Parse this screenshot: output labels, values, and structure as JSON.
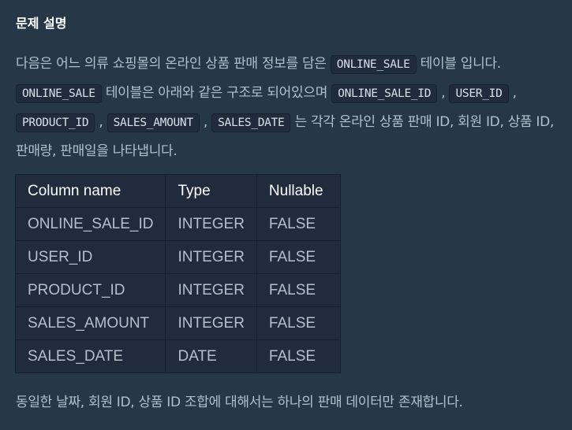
{
  "heading": "문제 설명",
  "intro": {
    "t1": "다음은 어느 의류 쇼핑몰의 온라인 상품 판매 정보를 담은 ",
    "code1": "ONLINE_SALE",
    "t2": " 테이블 입니다. ",
    "code2": "ONLINE_SALE",
    "t3": " 테이블은 아래와 같은 구조로 되어있으며 ",
    "code3": "ONLINE_SALE_ID",
    "sep1": " , ",
    "code4": "USER_ID",
    "sep2": " , ",
    "code5": "PRODUCT_ID",
    "sep3": " , ",
    "code6": "SALES_AMOUNT",
    "sep4": " , ",
    "code7": "SALES_DATE",
    "t4": " 는 각각 온라인 상품 판매 ID, 회원 ID, 상품 ID, 판매량, 판매일을 나타냅니다."
  },
  "table": {
    "headers": [
      "Column name",
      "Type",
      "Nullable"
    ],
    "rows": [
      [
        "ONLINE_SALE_ID",
        "INTEGER",
        "FALSE"
      ],
      [
        "USER_ID",
        "INTEGER",
        "FALSE"
      ],
      [
        "PRODUCT_ID",
        "INTEGER",
        "FALSE"
      ],
      [
        "SALES_AMOUNT",
        "INTEGER",
        "FALSE"
      ],
      [
        "SALES_DATE",
        "DATE",
        "FALSE"
      ]
    ]
  },
  "footer_text": "동일한 날짜, 회원 ID, 상품 ID 조합에 대해서는 하나의 판매 데이터만 존재합니다."
}
